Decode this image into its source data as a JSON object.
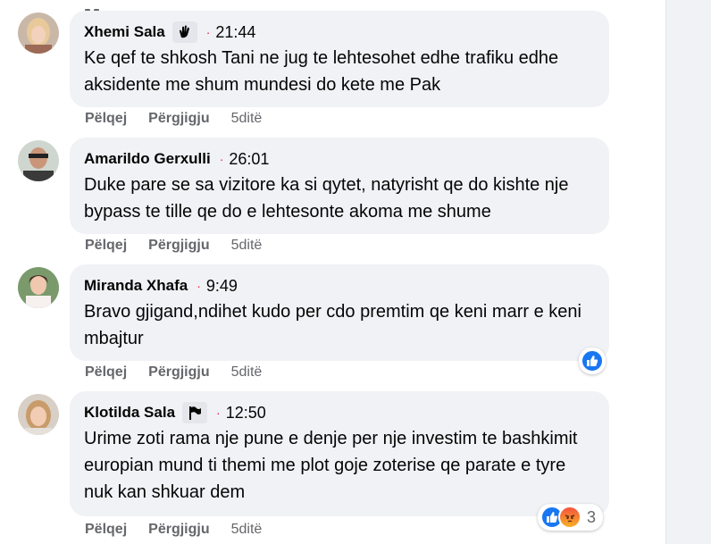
{
  "comments": [
    {
      "author": "Xhemi Sala",
      "badge": "hand-wave-icon",
      "time": "21:44",
      "text": "Ke qef te shkosh Tani ne jug te lehtesohet edhe trafiku edhe aksidente me shum mundesi do kete me Pak",
      "like_label": "Pëlqej",
      "reply_label": "Përgjigju",
      "age": "5ditë"
    },
    {
      "author": "Amarildo Gerxulli",
      "time": "26:01",
      "text": "Duke pare se sa vizitore ka si qytet, natyrisht qe do kishte nje bypass te tille qe do e lehtesonte akoma me shume",
      "like_label": "Pëlqej",
      "reply_label": "Përgjigju",
      "age": "5ditë"
    },
    {
      "author": "Miranda Xhafa",
      "time": "9:49",
      "text": "Bravo gjigand,ndihet kudo per cdo premtim qe keni marr e keni mbajtur",
      "like_label": "Pëlqej",
      "reply_label": "Përgjigju",
      "age": "5ditë",
      "reactions": [
        "like-icon"
      ]
    },
    {
      "author": "Klotilda Sala",
      "badge": "flag-icon",
      "time": "12:50",
      "text": "Urime zoti rama nje pune e denje per nje investim te bashkimit europian mund ti themi me plot goje zoterise qe parate e tyre nuk kan shkuar dem",
      "like_label": "Pëlqej",
      "reply_label": "Përgjigju",
      "age": "5ditë",
      "reactions": [
        "like-icon",
        "angry-icon"
      ],
      "reaction_count": "3"
    }
  ],
  "colors": {
    "bubble": "#f0f2f5",
    "like_blue": "#1877f2",
    "muted": "#65676b",
    "dot": "#e41e3f"
  }
}
